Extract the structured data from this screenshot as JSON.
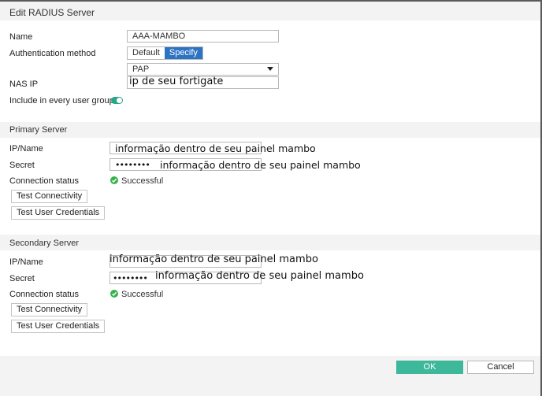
{
  "dialog": {
    "title": "Edit RADIUS Server"
  },
  "general": {
    "name_label": "Name",
    "name_value": "AAA-MAMBO",
    "auth_method_label": "Authentication method",
    "auth_options": [
      "Default",
      "Specify"
    ],
    "auth_selected": "Specify",
    "auth_protocol": "PAP",
    "nas_ip_label": "NAS IP",
    "nas_ip_value": "ip de seu fortigate",
    "include_group_label": "Include in every user group",
    "include_group_enabled": true
  },
  "primary": {
    "section_title": "Primary Server",
    "ip_label": "IP/Name",
    "ip_value": "informação dentro de seu painel mambo",
    "secret_label": "Secret",
    "secret_mask": "••••••••",
    "secret_note": "informação dentro de seu painel mambo",
    "conn_status_label": "Connection status",
    "conn_status_value": "Successful",
    "test_conn_label": "Test Connectivity",
    "test_cred_label": "Test User Credentials"
  },
  "secondary": {
    "section_title": "Secondary Server",
    "ip_label": "IP/Name",
    "ip_value": "informação dentro de seu painel mambo",
    "secret_label": "Secret",
    "secret_mask": "••••••••",
    "secret_note": "informação dentro de seu painel mambo",
    "conn_status_label": "Connection status",
    "conn_status_value": "Successful",
    "test_conn_label": "Test Connectivity",
    "test_cred_label": "Test User Credentials"
  },
  "footer": {
    "ok_label": "OK",
    "cancel_label": "Cancel"
  },
  "colors": {
    "accent": "#2d73c4",
    "ok": "#3db89b",
    "success": "#36b34a",
    "toggle": "#2ba58a",
    "band": "#f3f3f3"
  }
}
